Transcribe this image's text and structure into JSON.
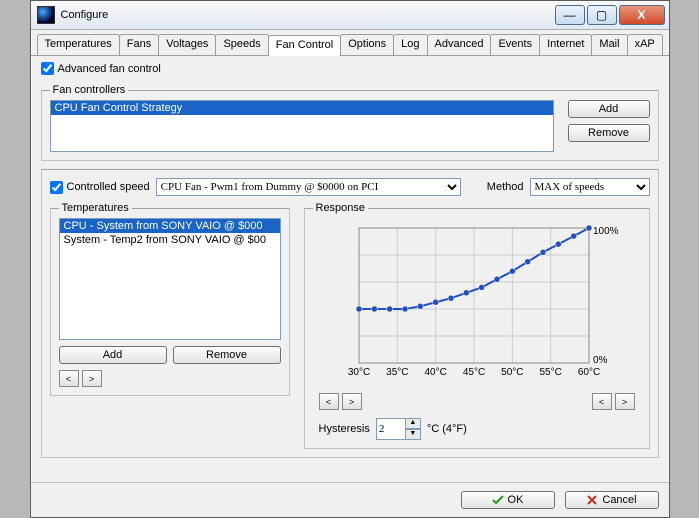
{
  "window": {
    "title": "Configure"
  },
  "win_buttons": {
    "min": "—",
    "max": "▢",
    "close": "X"
  },
  "tabs": [
    "Temperatures",
    "Fans",
    "Voltages",
    "Speeds",
    "Fan Control",
    "Options",
    "Log",
    "Advanced",
    "Events",
    "Internet",
    "Mail",
    "xAP"
  ],
  "active_tab": "Fan Control",
  "advanced_check": {
    "label": "Advanced fan control",
    "checked": true
  },
  "controllers": {
    "legend": "Fan controllers",
    "items": [
      "CPU Fan Control Strategy"
    ],
    "selected": 0,
    "add": "Add",
    "remove": "Remove"
  },
  "controlled_speed": {
    "checked": true,
    "label": "Controlled speed",
    "value": "CPU Fan - Pwm1 from Dummy @ $0000 on PCI"
  },
  "method": {
    "label": "Method",
    "value": "MAX of speeds"
  },
  "temps": {
    "legend": "Temperatures",
    "items": [
      "CPU - System from SONY VAIO @ $000",
      "System - Temp2 from SONY VAIO @ $00"
    ],
    "selected": 0,
    "add": "Add",
    "remove": "Remove"
  },
  "response": {
    "legend": "Response",
    "top_label": "100%",
    "bottom_label": "0%",
    "hysteresis_label": "Hysteresis",
    "hysteresis_value": "2",
    "hysteresis_unit": "°C (4°F)"
  },
  "chart_data": {
    "type": "line",
    "xlabel": "",
    "ylabel": "",
    "xlim": [
      30,
      60
    ],
    "ylim": [
      0,
      100
    ],
    "x_ticks": [
      "30°C",
      "35°C",
      "40°C",
      "45°C",
      "50°C",
      "55°C",
      "60°C"
    ],
    "points": [
      {
        "x": 30,
        "y": 40
      },
      {
        "x": 32,
        "y": 40
      },
      {
        "x": 34,
        "y": 40
      },
      {
        "x": 36,
        "y": 40
      },
      {
        "x": 38,
        "y": 42
      },
      {
        "x": 40,
        "y": 45
      },
      {
        "x": 42,
        "y": 48
      },
      {
        "x": 44,
        "y": 52
      },
      {
        "x": 46,
        "y": 56
      },
      {
        "x": 48,
        "y": 62
      },
      {
        "x": 50,
        "y": 68
      },
      {
        "x": 52,
        "y": 75
      },
      {
        "x": 54,
        "y": 82
      },
      {
        "x": 56,
        "y": 88
      },
      {
        "x": 58,
        "y": 94
      },
      {
        "x": 60,
        "y": 100
      }
    ]
  },
  "footer": {
    "ok": "OK",
    "cancel": "Cancel"
  }
}
